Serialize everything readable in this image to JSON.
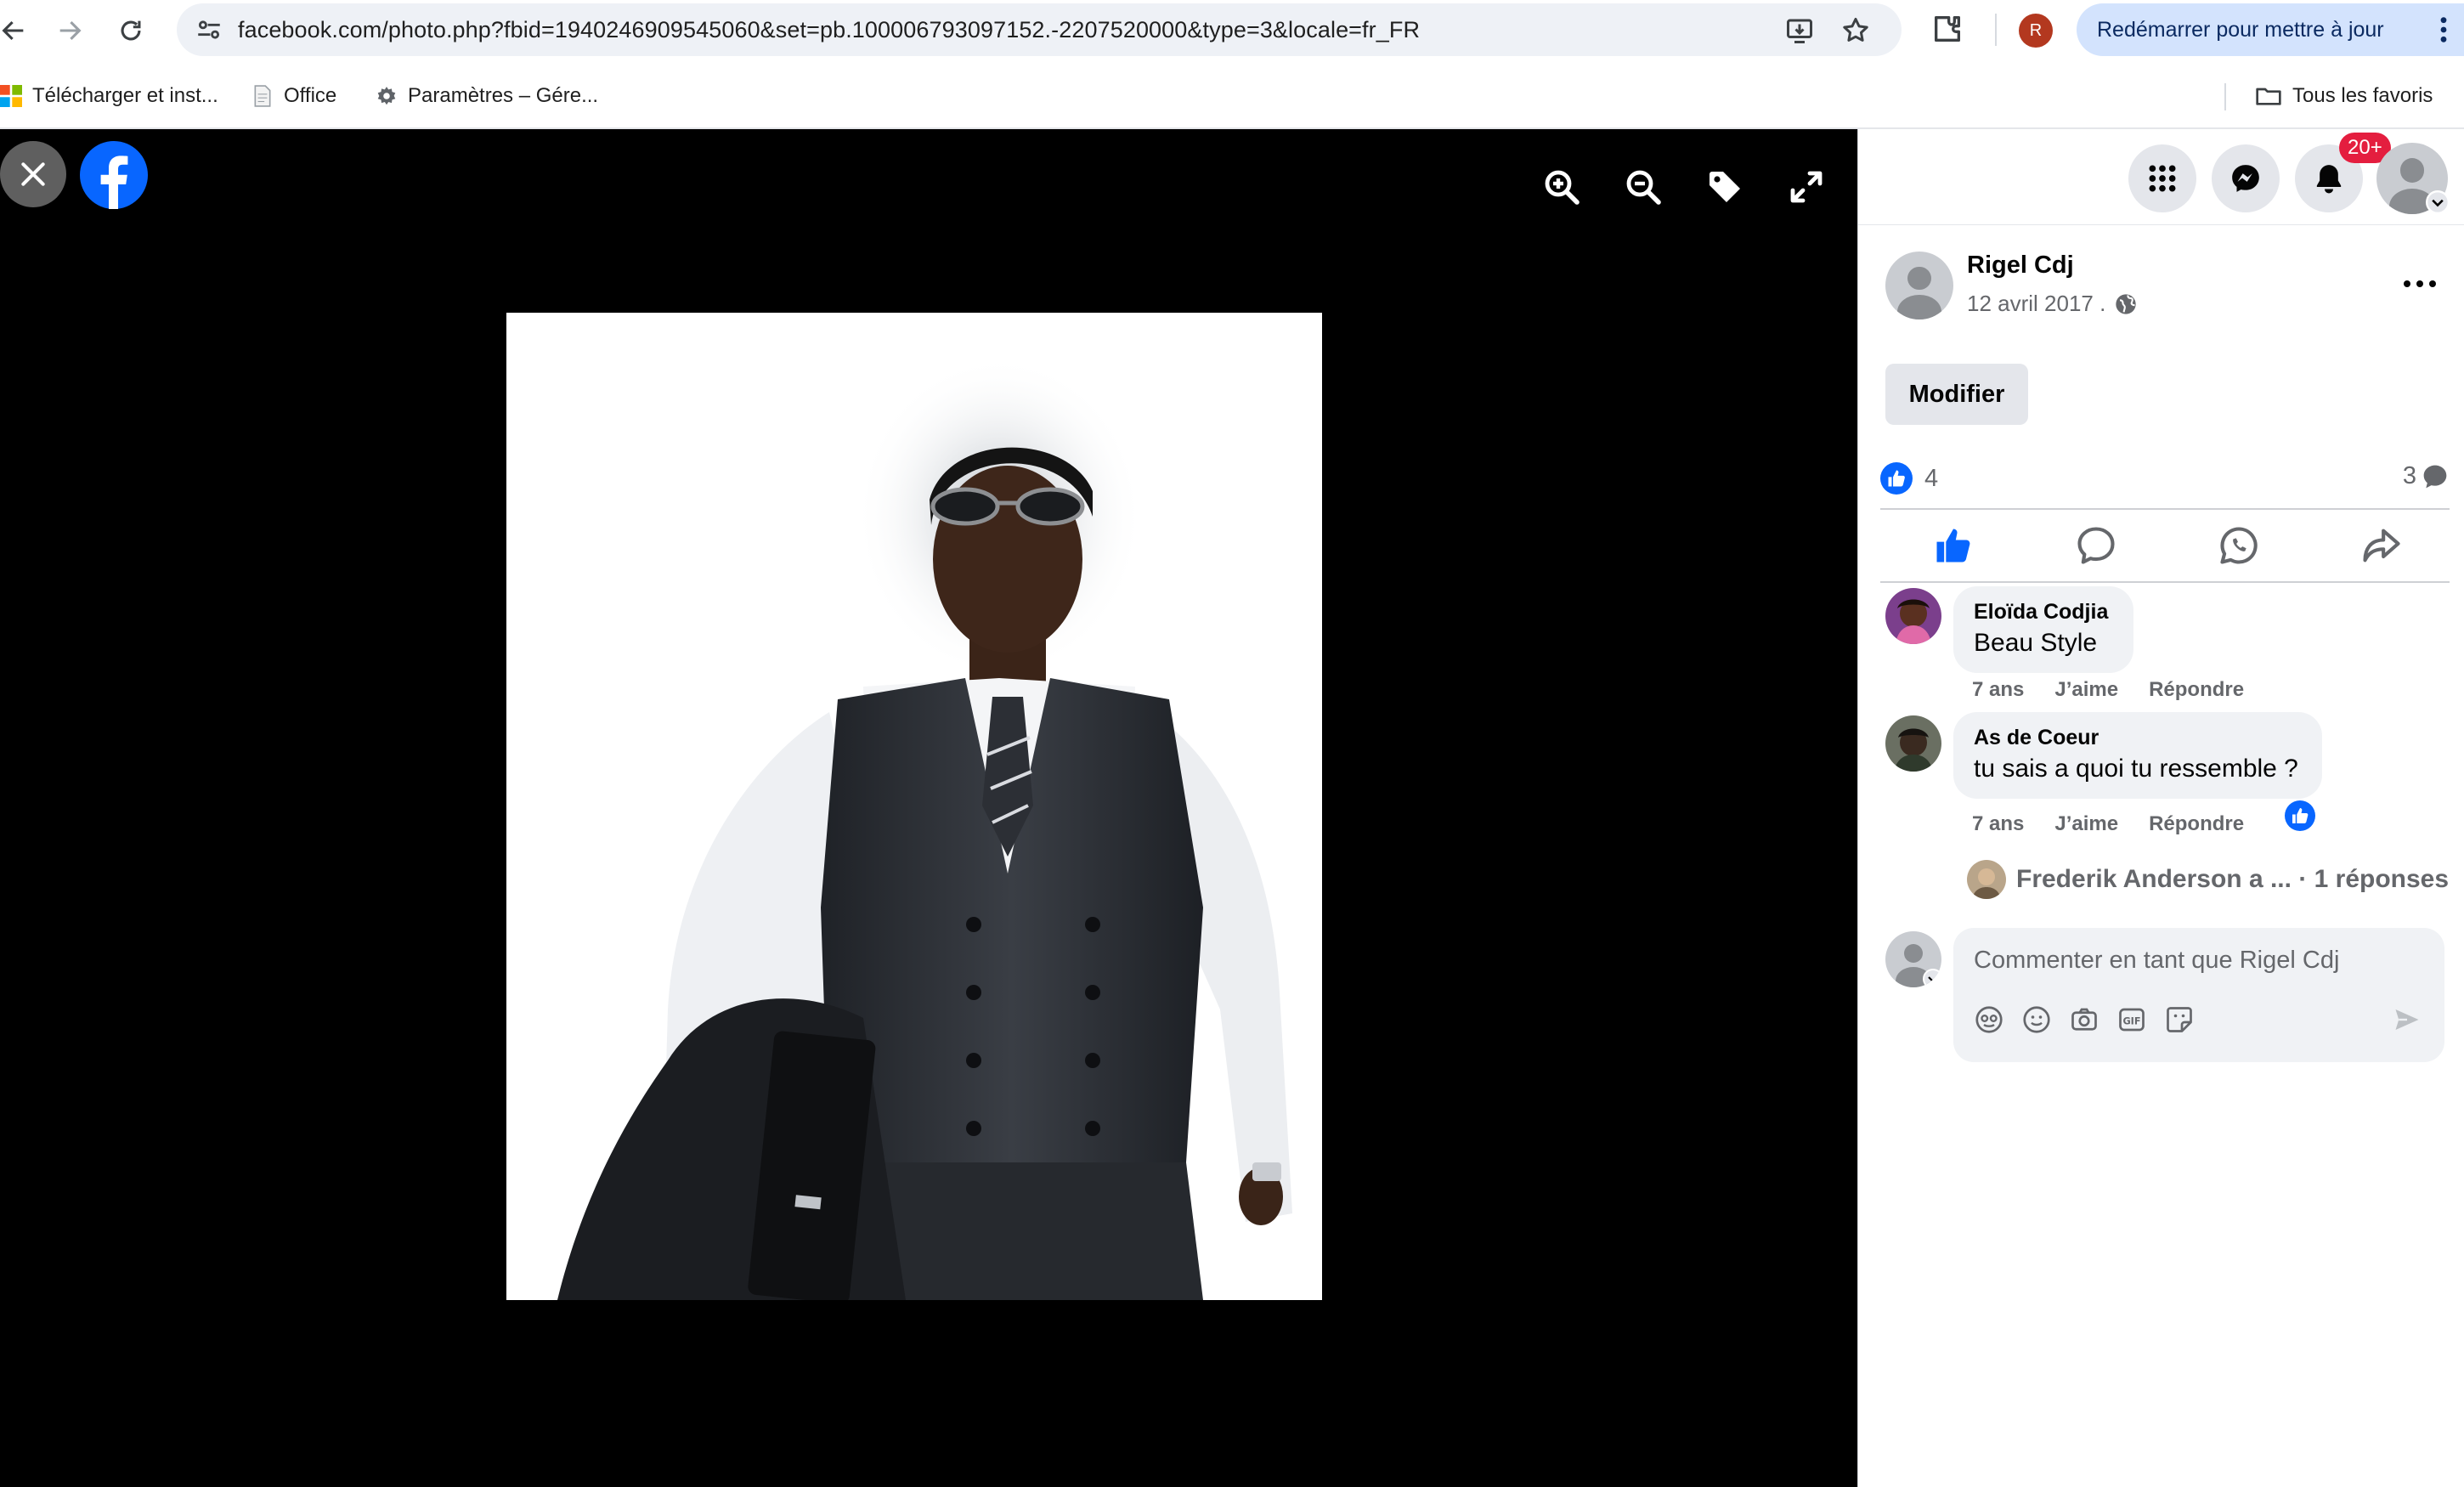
{
  "browser": {
    "url": "facebook.com/photo.php?fbid=1940246909545060&set=pb.100006793097152.-2207520000&type=3&locale=fr_FR",
    "profile_initial": "R",
    "update_button_label": "Redémarrer pour mettre à jour",
    "bookmarks": [
      {
        "label": "Télécharger et inst...",
        "icon": "microsoft-icon"
      },
      {
        "label": "Office",
        "icon": "document-icon"
      },
      {
        "label": "Paramètres – Gére...",
        "icon": "gear-icon"
      }
    ],
    "all_bookmarks_label": "Tous les favoris"
  },
  "viewer": {
    "tools": [
      "zoom-in-icon",
      "zoom-out-icon",
      "tag-icon",
      "fullscreen-icon"
    ]
  },
  "header": {
    "notification_badge": "20+"
  },
  "post": {
    "author": "Rigel Cdj",
    "date": "12 avril 2017 .",
    "edit_label": "Modifier",
    "like_count": "4",
    "comment_count": "3"
  },
  "comments": [
    {
      "author": "Eloïda Codjia",
      "text": "Beau Style",
      "time": "7 ans",
      "like": "J’aime",
      "reply": "Répondre"
    },
    {
      "author": "As de Coeur",
      "text": "tu sais a quoi tu ressemble ?",
      "time": "7 ans",
      "like": "J’aime",
      "reply": "Répondre"
    }
  ],
  "replies": {
    "label": "Frederik Anderson a ... · 1 réponses"
  },
  "composer": {
    "placeholder": "Commenter en tant que Rigel Cdj"
  },
  "colors": {
    "facebook_blue": "#0866ff",
    "badge_red": "#e41e3f",
    "update_button_bg": "#d3e3fd"
  }
}
